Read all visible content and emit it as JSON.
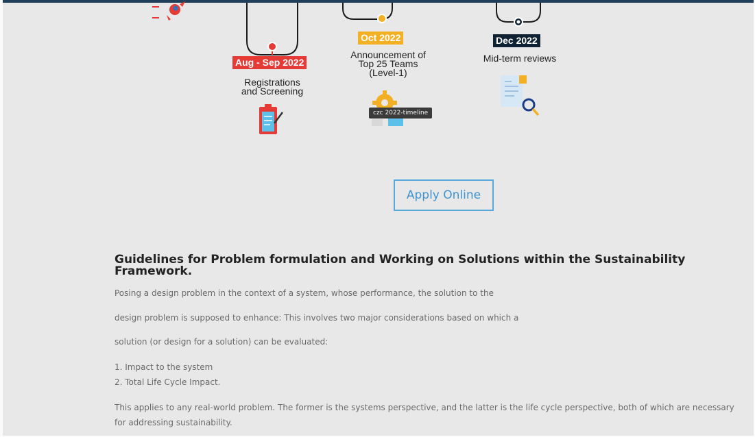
{
  "timeline": {
    "milestones": [
      {
        "date": "Aug - Sep 2022",
        "title_lines": [
          "Registrations",
          "and Screening"
        ],
        "color": "#e63a36"
      },
      {
        "date": "Oct 2022",
        "title_lines": [
          "Announcement of",
          "Top 25 Teams",
          "(Level-1)"
        ],
        "color": "#f4b024"
      },
      {
        "date": "Dec 2022",
        "title_lines": [
          "Mid-term reviews"
        ],
        "color": "#0f2233"
      }
    ],
    "tooltip": "czc 2022-timeline"
  },
  "apply_button": {
    "label": "Apply Online"
  },
  "guidelines": {
    "heading_lines": [
      "Guidelines for Problem formulation and Working on Solutions within the Sustainability",
      "Framework."
    ],
    "paragraphs": [
      "Posing a design problem in the context of a system, whose performance, the solution to the",
      "design problem is supposed to enhance: This involves two major considerations based on which a",
      "solution (or design for a solution) can be evaluated:"
    ],
    "list": [
      "1. Impact to the system",
      "2. Total Life Cycle Impact."
    ],
    "closing": "This applies to any real-world problem. The former is the systems perspective, and the latter is the life cycle perspective, both of which are necessary for addressing sustainability."
  },
  "icons": {
    "rocket": "rocket-icon",
    "clipboard": "clipboard-icon",
    "gear": "gear-icon",
    "document_search": "document-search-icon"
  }
}
